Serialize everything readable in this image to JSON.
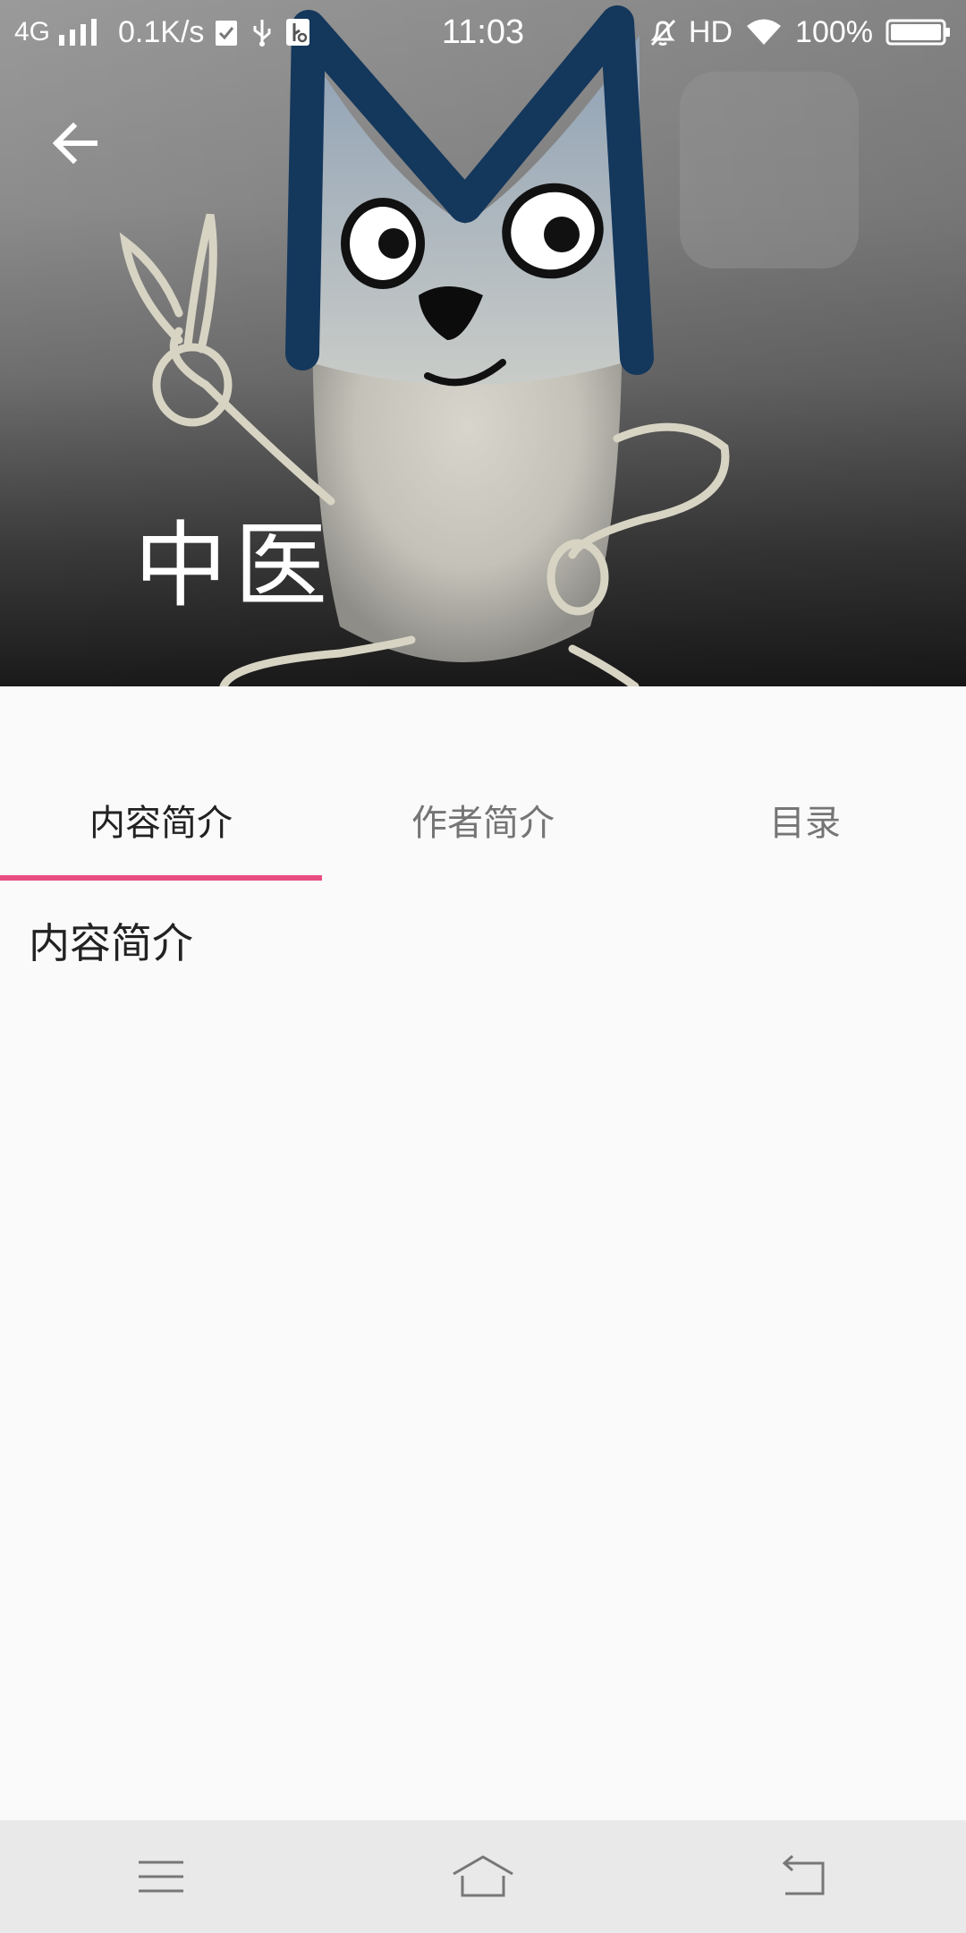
{
  "status_bar": {
    "network": "4G",
    "speed": "0.1K/s",
    "time": "11:03",
    "hd": "HD",
    "battery": "100%"
  },
  "header": {
    "title": "中医",
    "back_icon": "arrow-left-icon"
  },
  "tabs": [
    {
      "label": "内容简介",
      "active": true
    },
    {
      "label": "作者简介",
      "active": false
    },
    {
      "label": "目录",
      "active": false
    }
  ],
  "content": {
    "text": "内容简介"
  },
  "colors": {
    "accent": "#e94e82",
    "nav_bg": "#e9e9e9",
    "page_bg": "#fafafa"
  },
  "nav": {
    "menu_icon": "menu-icon",
    "home_icon": "home-icon",
    "back_icon": "return-icon"
  }
}
